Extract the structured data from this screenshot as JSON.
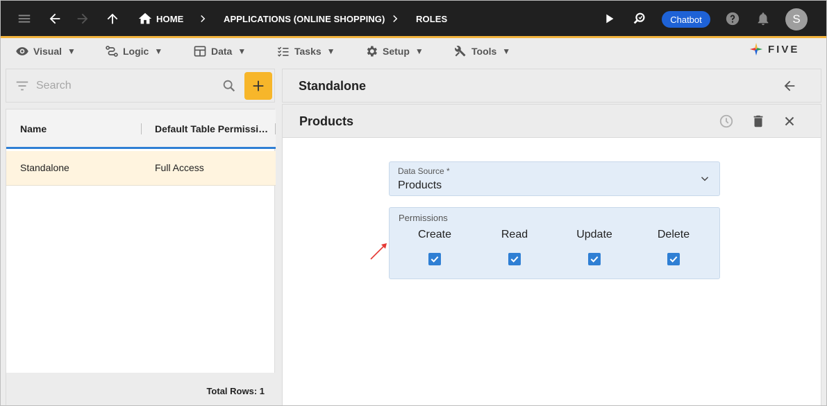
{
  "topbar": {
    "breadcrumbs": [
      "HOME",
      "APPLICATIONS (ONLINE SHOPPING)",
      "ROLES"
    ],
    "chatbot_label": "Chatbot",
    "avatar_initial": "S",
    "icons": [
      "menu-icon",
      "back-icon",
      "forward-icon",
      "up-icon",
      "home-icon",
      "run-icon",
      "search-data-icon",
      "help-icon",
      "notifications-icon"
    ],
    "accent_color": "#f2b33d",
    "chatbot_color": "#1e62d6"
  },
  "menubar": {
    "items": [
      {
        "label": "Visual",
        "icon": "eye-icon"
      },
      {
        "label": "Logic",
        "icon": "logic-icon"
      },
      {
        "label": "Data",
        "icon": "table-icon"
      },
      {
        "label": "Tasks",
        "icon": "tasks-icon"
      },
      {
        "label": "Setup",
        "icon": "gear-icon"
      },
      {
        "label": "Tools",
        "icon": "tools-icon"
      }
    ],
    "caret": "▼",
    "logo_text": "FIVE"
  },
  "search": {
    "placeholder": "Search"
  },
  "list": {
    "columns": [
      "Name",
      "Default Table Permissions"
    ],
    "rows": [
      {
        "name": "Standalone",
        "permission": "Full Access"
      }
    ],
    "total_label": "Total Rows: 1",
    "selected_row_color": "#fff4df"
  },
  "detail": {
    "record_title": "Standalone",
    "form_title": "Products",
    "data_source_label": "Data Source *",
    "data_source_value": "Products",
    "permissions_label": "Permissions",
    "permissions": [
      {
        "label": "Create",
        "checked": true
      },
      {
        "label": "Read",
        "checked": true
      },
      {
        "label": "Update",
        "checked": true
      },
      {
        "label": "Delete",
        "checked": true
      }
    ],
    "checkbox_color": "#2f7fd4"
  }
}
